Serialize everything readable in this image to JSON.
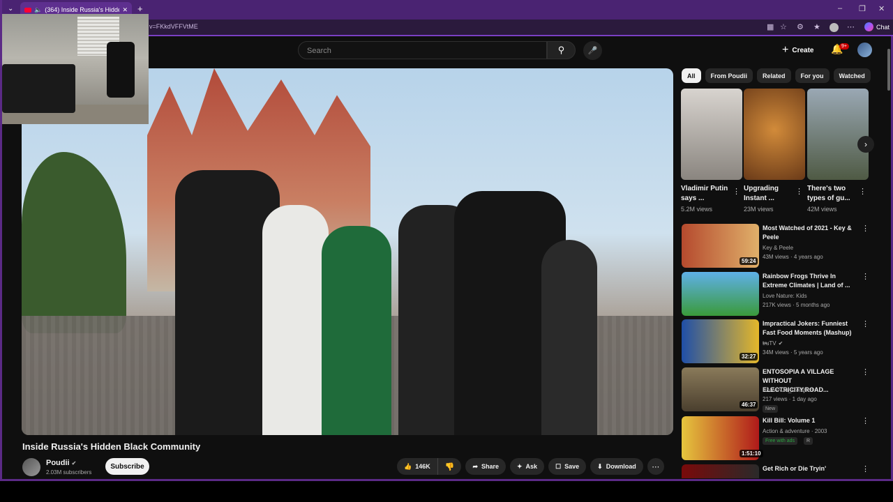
{
  "browser": {
    "tab_title": "(364) Inside Russia's Hidden B",
    "url": "v=FKkdVFFVtME",
    "chat_label": "Chat"
  },
  "masthead": {
    "search_placeholder": "Search",
    "create_label": "Create",
    "notif_count": "9+"
  },
  "video": {
    "title": "Inside Russia's Hidden Black Community",
    "channel": "Poudii",
    "subscribers": "2.03M subscribers",
    "subscribe_label": "Subscribe",
    "likes": "146K",
    "share_label": "Share",
    "ask_label": "Ask",
    "save_label": "Save",
    "download_label": "Download"
  },
  "chips": [
    "All",
    "From Poudii",
    "Related",
    "For you",
    "Watched"
  ],
  "shorts": [
    {
      "title": "Vladimir Putin says ...",
      "views": "5.2M views",
      "color": "#c8c4bf"
    },
    {
      "title": "Upgrading Instant ...",
      "views": "23M views",
      "color": "#8a4a22"
    },
    {
      "title": "There's two types of gu...",
      "views": "42M views",
      "color": "#6d7a86"
    }
  ],
  "recommendations": [
    {
      "title": "Most Watched of 2021 - Key & Peele",
      "channel": "Key & Peele",
      "meta": "43M views · 4 years ago",
      "duration": "59:24",
      "color": "#a13a2a"
    },
    {
      "title": "Rainbow Frogs Thrive In Extreme Climates | Land of ...",
      "channel": "Love Nature: Kids",
      "meta": "217K views · 5 months ago",
      "duration": "",
      "color": "#3a8ac9"
    },
    {
      "title": "Impractical Jokers: Funniest Fast Food Moments (Mashup) ...",
      "channel": "truTV",
      "meta": "34M views · 5 years ago",
      "duration": "32:27",
      "color": "#2a5fb0"
    },
    {
      "title": "ENTOSOPIA A VILLAGE WITHOUT ELECTRICITY,ROAD...",
      "channel": "KARANJA_GACHUI",
      "meta": "217 views · 1 day ago",
      "duration": "46:37",
      "tag": "New",
      "color": "#6b5a3e"
    },
    {
      "title": "Kill Bill: Volume 1",
      "channel": "Action & adventure · 2003",
      "meta": "",
      "duration": "1:51:10",
      "tag": "Free with ads",
      "rating": "R",
      "color": "#e0c23a"
    },
    {
      "title": "Get Rich or Die Tryin'",
      "channel": "",
      "meta": "",
      "duration": "",
      "color": "#8a1010"
    }
  ]
}
